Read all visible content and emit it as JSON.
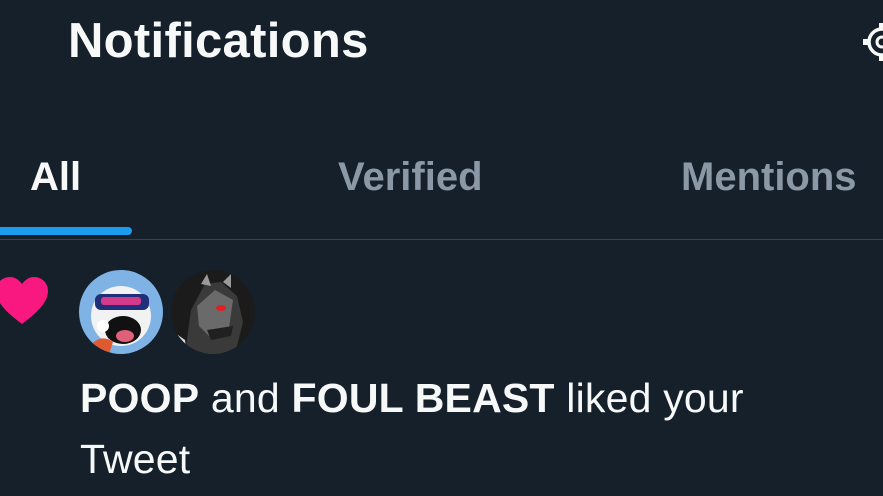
{
  "header": {
    "title": "Notifications",
    "settings_icon": "settings-gear-icon"
  },
  "tabs": [
    {
      "label": "All",
      "active": true
    },
    {
      "label": "Verified",
      "active": false
    },
    {
      "label": "Mentions",
      "active": false
    }
  ],
  "notification": {
    "type_icon": "heart-icon",
    "type_color": "#f91880",
    "avatars": [
      "avatar-poop",
      "avatar-foul-beast"
    ],
    "user1": "POOP",
    "connector": "and",
    "user2": "FOUL BEAST",
    "action": "liked your Tweet"
  },
  "colors": {
    "background": "#15202b",
    "accent": "#1d9bf0",
    "inactive_tab": "#8b98a5",
    "divider": "#38444d"
  }
}
